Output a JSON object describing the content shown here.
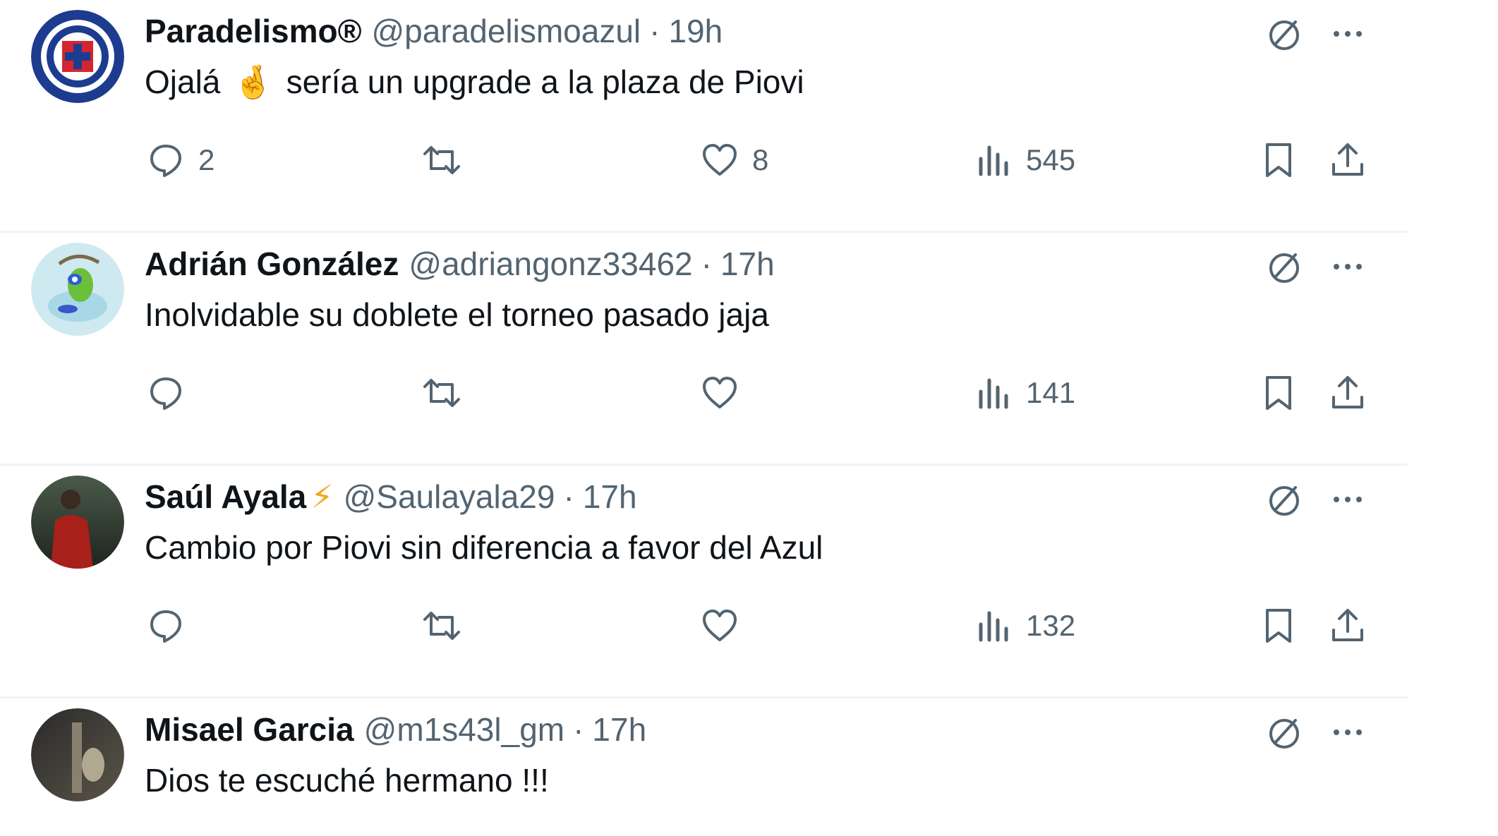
{
  "tweets": [
    {
      "name": "Paradelismo®",
      "name_emoji": "",
      "handle": "@paradelismoazul",
      "separator": "·",
      "time": "19h",
      "text_before": "Ojalá",
      "text_emoji": "🤞",
      "text_after": "sería un upgrade a la plaza de Piovi",
      "replies": "2",
      "retweets": "",
      "likes": "8",
      "views": "545",
      "avatar": "cruz-azul-logo-avatar"
    },
    {
      "name": "Adrián González",
      "name_emoji": "",
      "handle": "@adriangonz33462",
      "separator": "·",
      "time": "17h",
      "text_before": "Inolvidable su doblete el torneo pasado jaja",
      "text_emoji": "",
      "text_after": "",
      "replies": "",
      "retweets": "",
      "likes": "",
      "views": "141",
      "avatar": "cartoon-avatar"
    },
    {
      "name": "Saúl Ayala",
      "name_emoji": "⚡",
      "handle": "@Saulayala29",
      "separator": "·",
      "time": "17h",
      "text_before": "Cambio por Piovi sin diferencia a favor del Azul",
      "text_emoji": "",
      "text_after": "",
      "replies": "",
      "retweets": "",
      "likes": "",
      "views": "132",
      "avatar": "photo-avatar"
    },
    {
      "name": "Misael Garcia",
      "name_emoji": "",
      "handle": "@m1s43l_gm",
      "separator": "·",
      "time": "17h",
      "text_before": "Dios te escuché hermano !!!",
      "text_emoji": "",
      "text_after": "",
      "avatar": "photo-avatar"
    }
  ],
  "icons": {
    "reply": "reply-icon",
    "retweet": "retweet-icon",
    "like": "heart-icon",
    "views": "views-icon",
    "bookmark": "bookmark-icon",
    "share": "share-icon",
    "grok": "grok-icon",
    "more": "more-icon"
  },
  "colors": {
    "text": "#0f1419",
    "secondary": "#536471",
    "divider": "#eff3f4",
    "brand_blue": "#1d3c8f"
  }
}
